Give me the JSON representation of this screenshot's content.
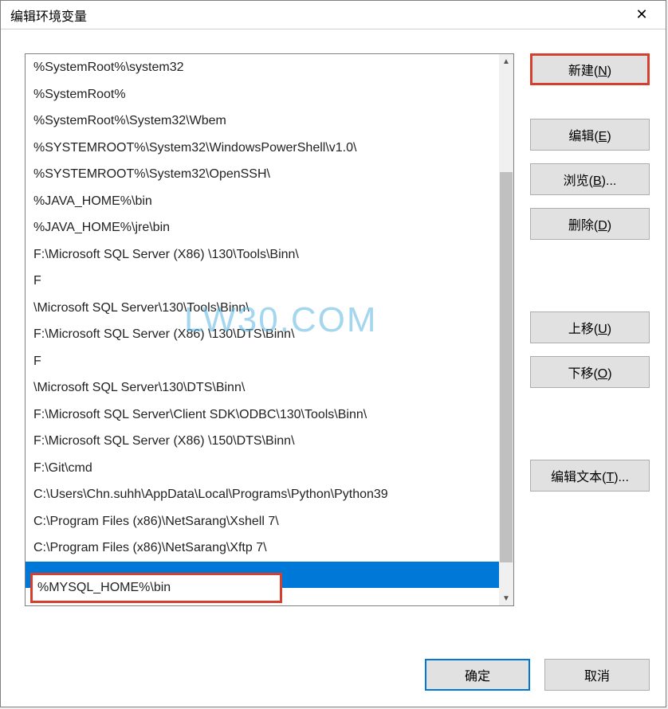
{
  "window": {
    "title": "编辑环境变量"
  },
  "list": {
    "items": [
      "%SystemRoot%\\system32",
      "%SystemRoot%",
      "%SystemRoot%\\System32\\Wbem",
      "%SYSTEMROOT%\\System32\\WindowsPowerShell\\v1.0\\",
      "%SYSTEMROOT%\\System32\\OpenSSH\\",
      "%JAVA_HOME%\\bin",
      "%JAVA_HOME%\\jre\\bin",
      "F:\\Microsoft SQL Server  (X86)  \\130\\Tools\\Binn\\",
      "F",
      "\\Microsoft SQL Server\\130\\Tools\\Binn\\",
      "F:\\Microsoft SQL Server  (X86)  \\130\\DTS\\Binn\\",
      "F",
      "\\Microsoft SQL Server\\130\\DTS\\Binn\\",
      "F:\\Microsoft SQL Server\\Client SDK\\ODBC\\130\\Tools\\Binn\\",
      "F:\\Microsoft SQL Server  (X86)  \\150\\DTS\\Binn\\",
      "F:\\Git\\cmd",
      "C:\\Users\\Chn.suhh\\AppData\\Local\\Programs\\Python\\Python39",
      "C:\\Program Files (x86)\\NetSarang\\Xshell 7\\",
      "C:\\Program Files (x86)\\NetSarang\\Xftp 7\\"
    ],
    "editing_value": "%MYSQL_HOME%\\bin",
    "selected_index": 19
  },
  "buttons": {
    "new": "新建(N)",
    "edit": "编辑(E)",
    "browse": "浏览(B)...",
    "delete": "删除(D)",
    "move_up": "上移(U)",
    "move_down": "下移(O)",
    "edit_text": "编辑文本(T)...",
    "ok": "确定",
    "cancel": "取消"
  },
  "watermark": "LW30.COM"
}
